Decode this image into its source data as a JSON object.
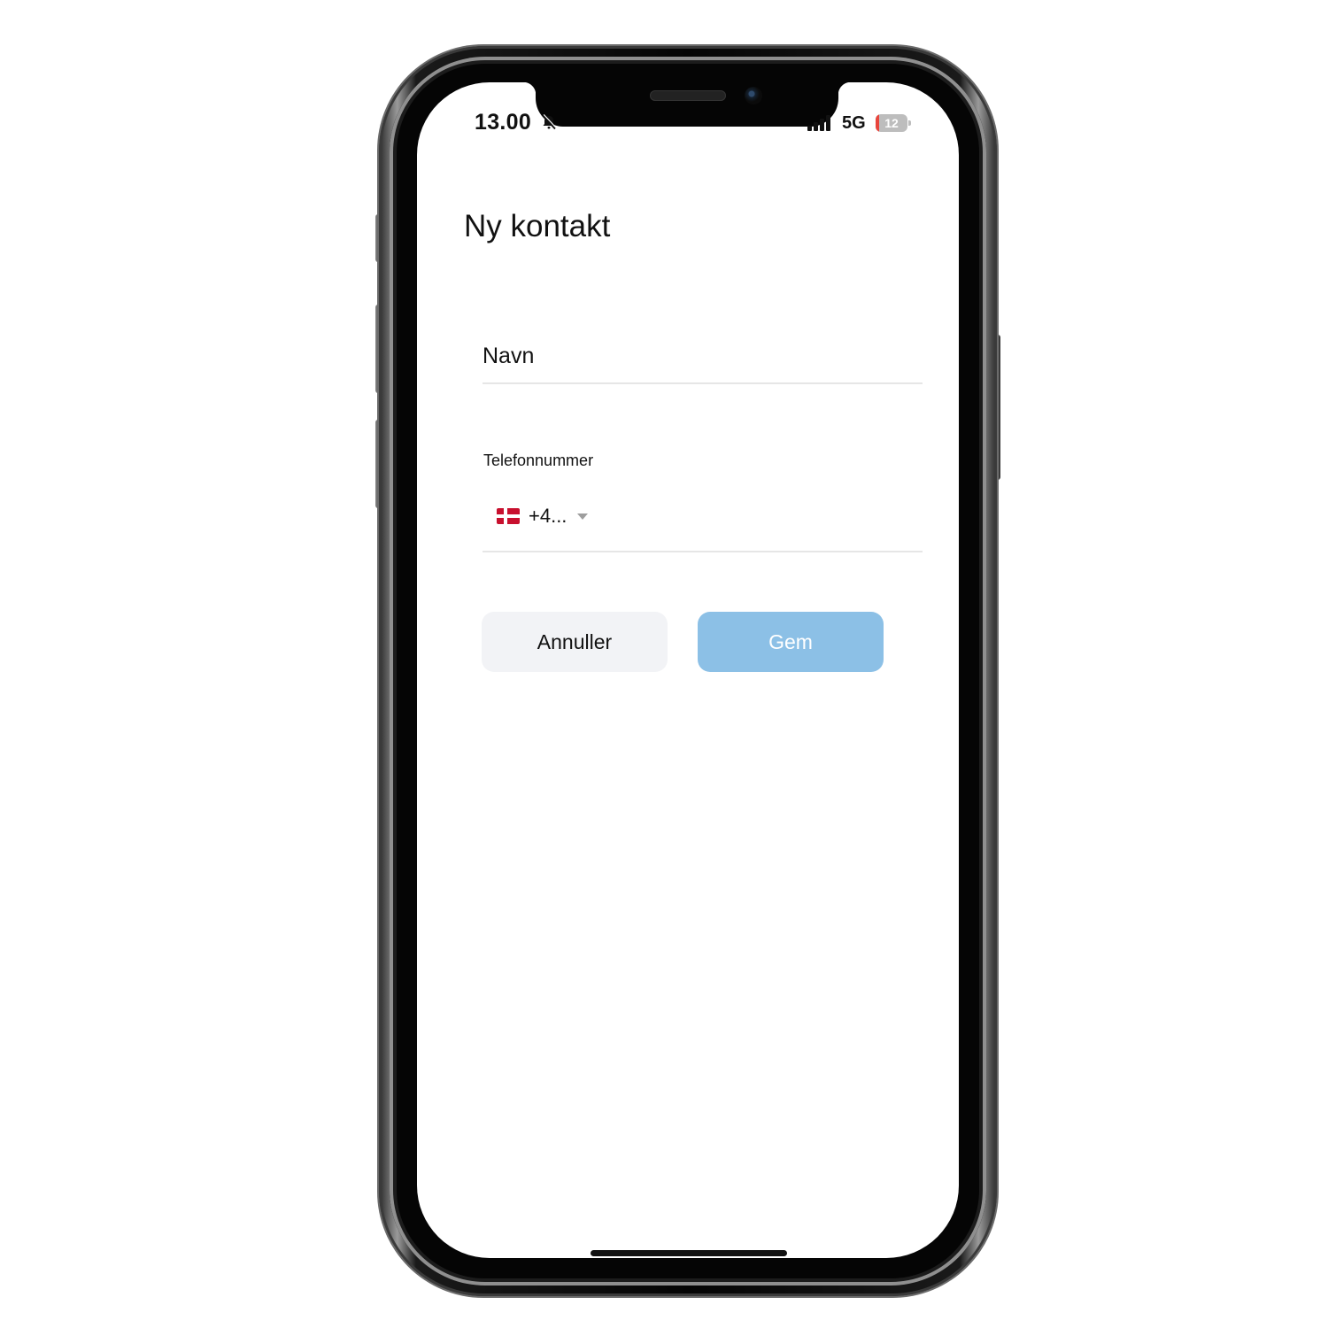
{
  "status_bar": {
    "time": "13.00",
    "network": "5G",
    "battery_level": "12",
    "battery_fraction": 0.12,
    "icons": [
      "bell-muted-icon",
      "cellular-signal-icon",
      "battery-charging-icon"
    ]
  },
  "form": {
    "title": "Ny kontakt",
    "name_placeholder": "Navn",
    "name_value": "",
    "phone_label": "Telefonnummer",
    "country_flag": "denmark-flag-icon",
    "dial_code": "+4...",
    "phone_value": ""
  },
  "actions": {
    "cancel_label": "Annuller",
    "save_label": "Gem"
  },
  "colors": {
    "save_button": "#8cc0e6",
    "cancel_button": "#f2f3f6",
    "battery_low": "#e8453c",
    "flag_red": "#c8102e"
  }
}
